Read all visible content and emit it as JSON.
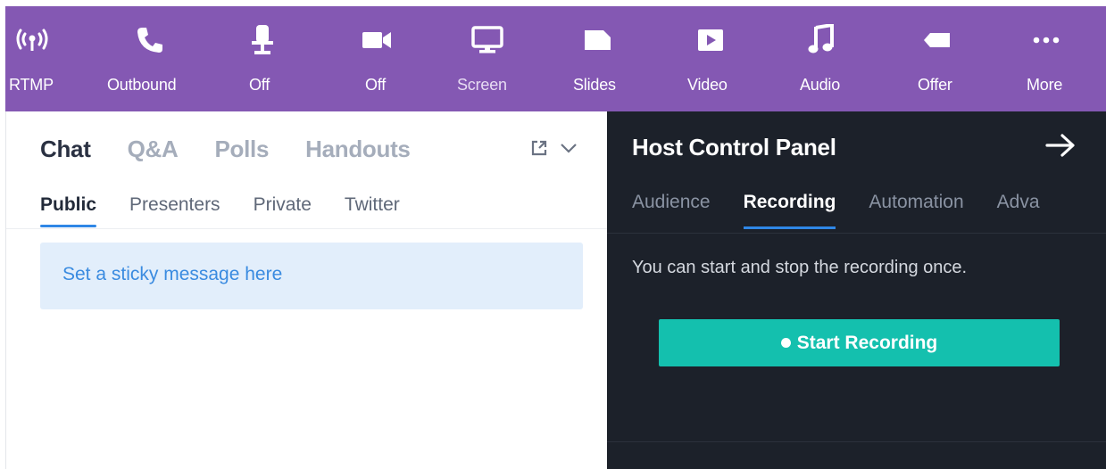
{
  "toolbar": {
    "items": [
      {
        "label": "RTMP",
        "icon": "broadcast-icon"
      },
      {
        "label": "Outbound",
        "icon": "phone-icon"
      },
      {
        "label": "Off",
        "icon": "microphone-icon"
      },
      {
        "label": "Off",
        "icon": "video-camera-icon"
      },
      {
        "label": "Screen",
        "icon": "monitor-icon"
      },
      {
        "label": "Slides",
        "icon": "slides-icon"
      },
      {
        "label": "Video",
        "icon": "play-icon"
      },
      {
        "label": "Audio",
        "icon": "music-note-icon"
      },
      {
        "label": "Offer",
        "icon": "tag-icon"
      },
      {
        "label": "More",
        "icon": "more-icon"
      }
    ],
    "background": "#8458b3"
  },
  "chat": {
    "tabs": [
      "Chat",
      "Q&A",
      "Polls",
      "Handouts"
    ],
    "active_tab": "Chat",
    "subtabs": [
      "Public",
      "Presenters",
      "Private",
      "Twitter"
    ],
    "active_subtab": "Public",
    "sticky_placeholder": "Set a sticky message here"
  },
  "host": {
    "title": "Host Control Panel",
    "tabs": [
      "Audience",
      "Recording",
      "Automation",
      "Adva"
    ],
    "active_tab": "Recording",
    "description": "You can start and stop the recording once.",
    "record_button": "Start Recording",
    "accent": "#14c0ae",
    "background": "#1c212a"
  }
}
